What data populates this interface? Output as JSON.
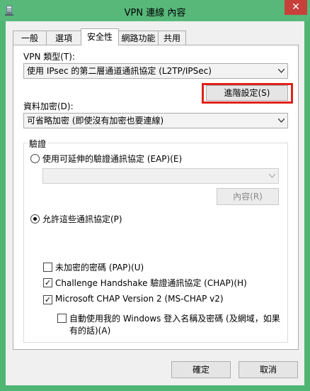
{
  "window": {
    "title": "VPN 連線 內容",
    "close_glyph": "✕"
  },
  "tabs": [
    {
      "label": "一般"
    },
    {
      "label": "選項"
    },
    {
      "label": "安全性",
      "active": true
    },
    {
      "label": "網路功能"
    },
    {
      "label": "共用"
    }
  ],
  "vpn_type": {
    "label": "VPN 類型(T):",
    "value": "使用 IPsec 的第二層通道通訊協定 (L2TP/IPSec)"
  },
  "advanced_button": "進階設定(S)",
  "encryption": {
    "label": "資料加密(D):",
    "value": "可省略加密 (即使沒有加密也要連線)"
  },
  "auth": {
    "group_label": "驗證",
    "eap_radio": "使用可延伸的驗證通訊協定 (EAP)(E)",
    "eap_select_value": "",
    "properties_button": "內容(R)",
    "allow_radio": "允許這些通訊協定(P)",
    "protocols": [
      {
        "label": "未加密的密碼 (PAP)(U)",
        "checked": false
      },
      {
        "label": "Challenge Handshake 驗證通訊協定 (CHAP)(H)",
        "checked": true
      },
      {
        "label": "Microsoft CHAP Version 2 (MS-CHAP v2)",
        "checked": true
      }
    ],
    "auto_logon_line1": "自動使用我的 Windows 登入名稱及密碼 (及網域，如果",
    "auto_logon_line2": "有的話)(A)",
    "auto_logon_checked": false
  },
  "footer": {
    "ok": "確定",
    "cancel": "取消"
  },
  "colors": {
    "frame": "#4fb573",
    "close": "#c7413a",
    "highlight": "#e0211c"
  }
}
